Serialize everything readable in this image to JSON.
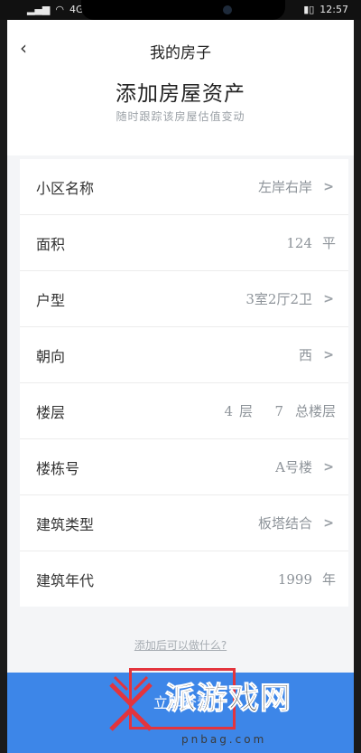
{
  "status": {
    "signal": "4G",
    "time": "12:57",
    "battery": "▮▯"
  },
  "nav": {
    "title": "我的房子"
  },
  "page": {
    "title": "添加房屋资产",
    "subtitle": "随时跟踪该房屋估值变动"
  },
  "rows": [
    {
      "label": "小区名称",
      "value": "左岸右岸"
    },
    {
      "label": "面积",
      "value": "124",
      "unit": "平"
    },
    {
      "label": "户型",
      "value": "3室2厅2卫"
    },
    {
      "label": "朝向",
      "value": "西"
    },
    {
      "label": "楼层",
      "floor": "4",
      "floor_unit": "层",
      "total": "7",
      "total_unit": "总楼层"
    },
    {
      "label": "楼栋号",
      "value": "A号楼"
    },
    {
      "label": "建筑类型",
      "value": "板塔结合"
    },
    {
      "label": "建筑年代",
      "value": "1999",
      "unit": "年"
    }
  ],
  "help": {
    "text": "添加后可以做什么?"
  },
  "submit": {
    "label": "立即查看"
  },
  "watermark": {
    "text": "派游戏网",
    "url": "pnbag.com"
  },
  "colors": {
    "primary": "#3d86e8",
    "highlight": "#e3343d"
  }
}
